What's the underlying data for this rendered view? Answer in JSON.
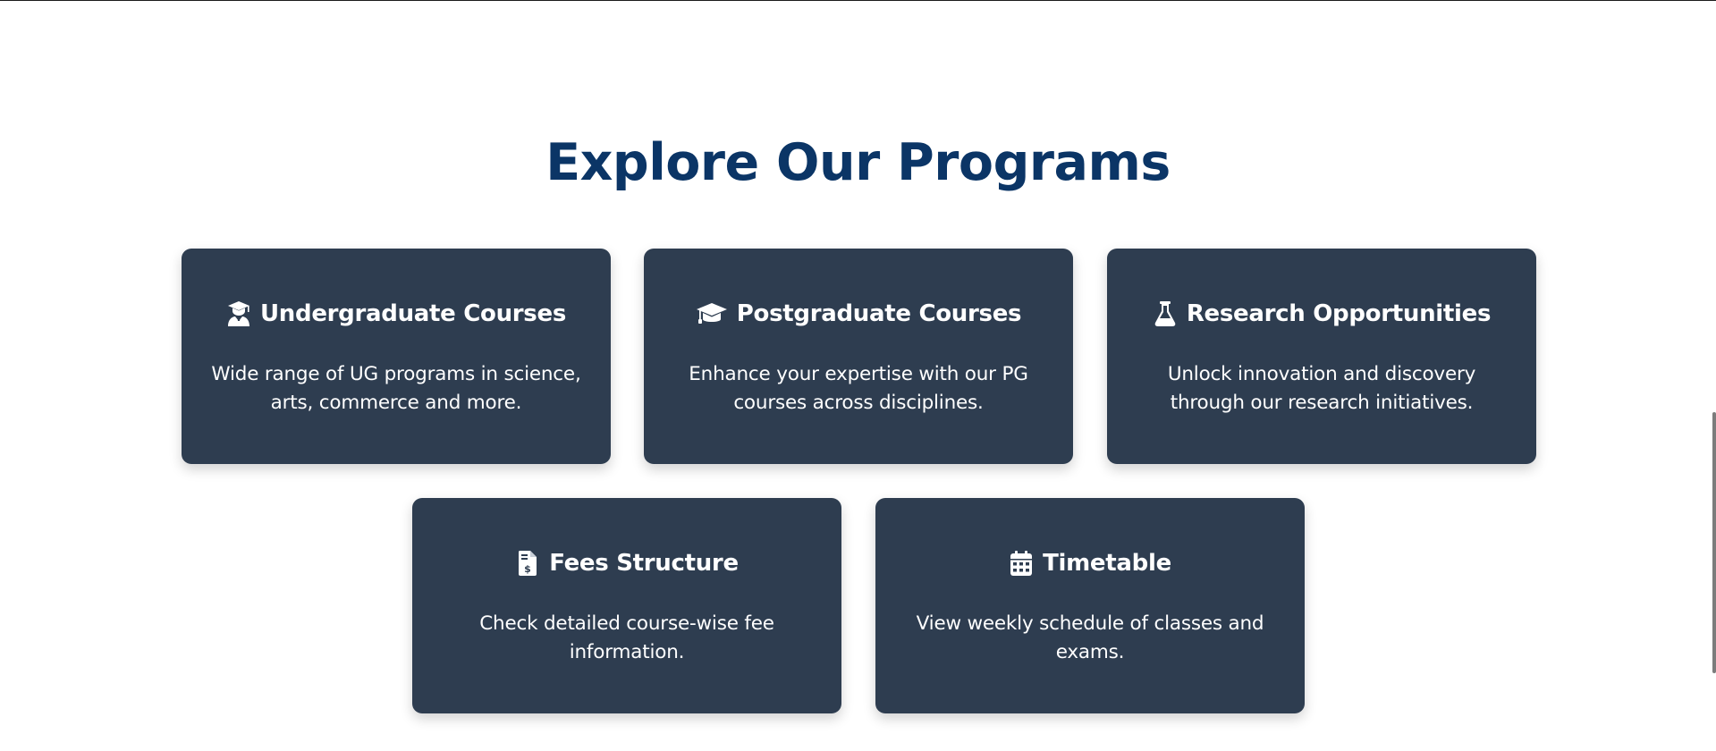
{
  "section": {
    "title": "Explore Our Programs"
  },
  "cards": [
    {
      "icon": "graduate-user-icon",
      "title": "Undergraduate Courses",
      "description": "Wide range of UG programs in science, arts, commerce and more."
    },
    {
      "icon": "graduation-cap-icon",
      "title": "Postgraduate Courses",
      "description": "Enhance your expertise with our PG courses across disciplines."
    },
    {
      "icon": "flask-icon",
      "title": "Research Opportunities",
      "description": "Unlock innovation and discovery through our research initiatives."
    },
    {
      "icon": "invoice-dollar-icon",
      "title": "Fees Structure",
      "description": "Check detailed course-wise fee information."
    },
    {
      "icon": "calendar-icon",
      "title": "Timetable",
      "description": "View weekly schedule of classes and exams."
    }
  ],
  "colors": {
    "title": "#0b3566",
    "card_background": "#2e3d50",
    "card_text": "#ffffff"
  }
}
